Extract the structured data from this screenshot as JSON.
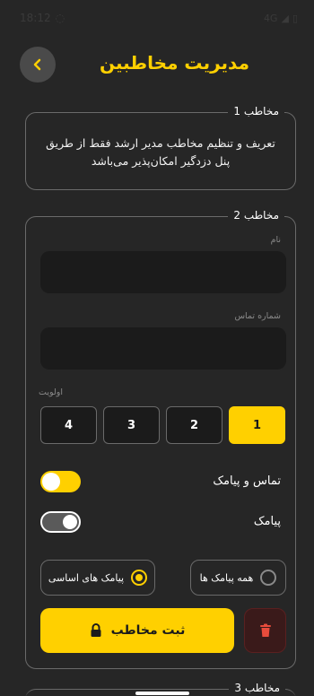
{
  "status_bar": {
    "time": "18:12",
    "left_icon": "circle-icon",
    "right_icons": [
      "wifi-icon",
      "signal-icon",
      "battery-icon"
    ],
    "network": "4G"
  },
  "header": {
    "title": "مدیریت مخاطبین",
    "back_icon": "chevron-left-icon"
  },
  "contact1": {
    "legend": "مخاطب 1",
    "text": "تعریف و تنظیم مخاطب مدیر ارشد فقط از طریق پنل دزدگیر امکان‌پذیر می‌باشد"
  },
  "contact2": {
    "legend": "مخاطب 2",
    "name_label": "نام",
    "name_value": "",
    "phone_label": "شماره تماس",
    "phone_value": "",
    "priority_label": "اولویت",
    "priority_options": [
      "1",
      "2",
      "3",
      "4"
    ],
    "priority_selected": "1",
    "toggle_call_sms_label": "تماس و پیامک",
    "toggle_call_sms_on": true,
    "toggle_sms_label": "پیامک",
    "toggle_sms_on": false,
    "radio_all_label": "همه پیامک ها",
    "radio_basic_label": "پیامک های اساسی",
    "radio_selected": "basic",
    "submit_label": "ثبت مخاطب",
    "submit_icon": "lock-icon",
    "delete_icon": "trash-icon"
  },
  "contact3": {
    "legend": "مخاطب 3"
  },
  "colors": {
    "background": "#262626",
    "accent": "#ffd000",
    "input_bg": "#1b1b1b",
    "border": "#6a6a6a",
    "danger": "#e74c3c"
  }
}
